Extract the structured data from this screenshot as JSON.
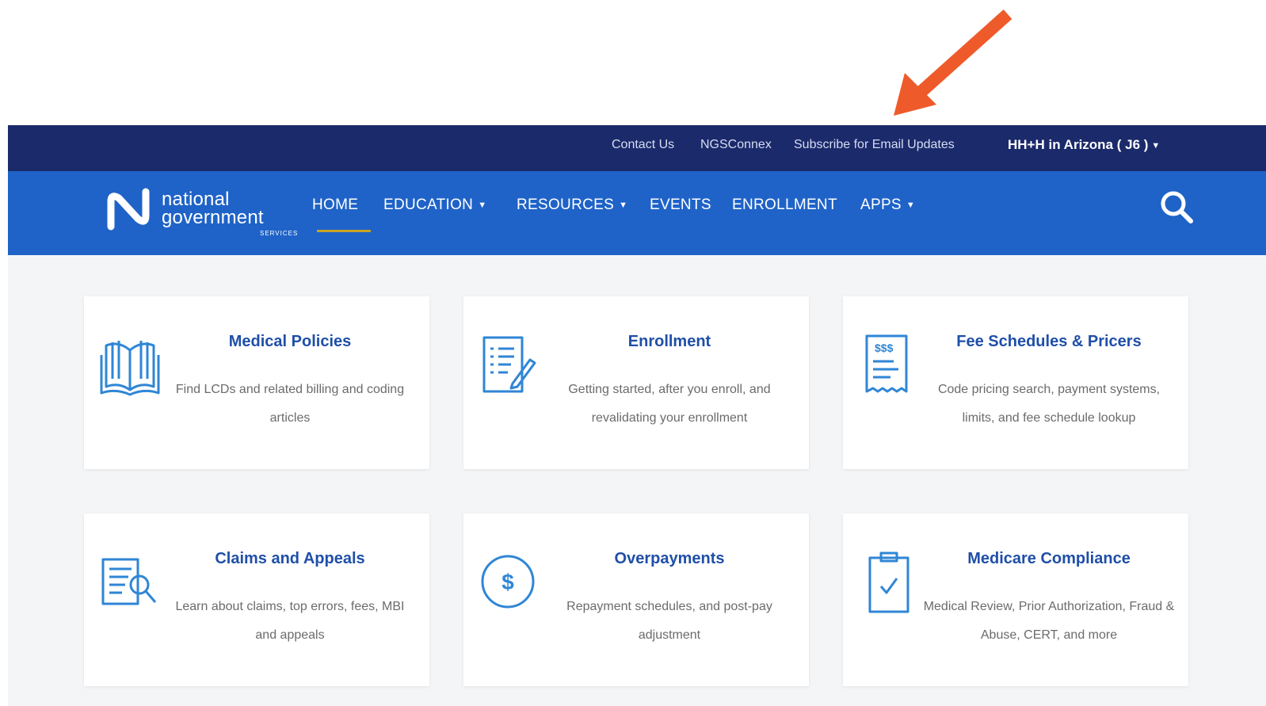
{
  "utility_bar": {
    "links": [
      "Contact Us",
      "NGSConnex",
      "Subscribe for Email Updates"
    ],
    "region_selector": "HH+H in Arizona ( J6 )"
  },
  "logo": {
    "line1": "national",
    "line2": "government",
    "line3": "SERVICES"
  },
  "nav": {
    "items": [
      {
        "label": "HOME",
        "active": true,
        "dropdown": false
      },
      {
        "label": "EDUCATION",
        "active": false,
        "dropdown": true
      },
      {
        "label": "RESOURCES",
        "active": false,
        "dropdown": true
      },
      {
        "label": "EVENTS",
        "active": false,
        "dropdown": false
      },
      {
        "label": "ENROLLMENT",
        "active": false,
        "dropdown": false
      },
      {
        "label": "APPS",
        "active": false,
        "dropdown": true
      }
    ],
    "search_icon": "search-icon"
  },
  "cards": [
    {
      "title": "Medical Policies",
      "desc": "Find LCDs and related billing and coding articles",
      "icon": "book-icon"
    },
    {
      "title": "Enrollment",
      "desc": "Getting started, after you enroll, and revalidating your enrollment",
      "icon": "form-pen-icon"
    },
    {
      "title": "Fee Schedules & Pricers",
      "desc": "Code pricing search, payment systems, limits, and fee schedule lookup",
      "icon": "receipt-icon"
    },
    {
      "title": "Claims and Appeals",
      "desc": "Learn about claims, top errors, fees, MBI and appeals",
      "icon": "document-search-icon"
    },
    {
      "title": "Overpayments",
      "desc": "Repayment schedules, and post-pay adjustment",
      "icon": "dollar-coin-icon"
    },
    {
      "title": "Medicare Compliance",
      "desc": "Medical Review, Prior Authorization, Fraud & Abuse, CERT, and more",
      "icon": "clipboard-check-icon"
    }
  ],
  "colors": {
    "utility_bar_bg": "#1b2a6b",
    "nav_bg": "#1f63c8",
    "active_underline": "#c9a227",
    "card_title": "#1f4fa8",
    "icon_blue": "#2f86d6",
    "annotation_arrow": "#ef5a2a"
  }
}
